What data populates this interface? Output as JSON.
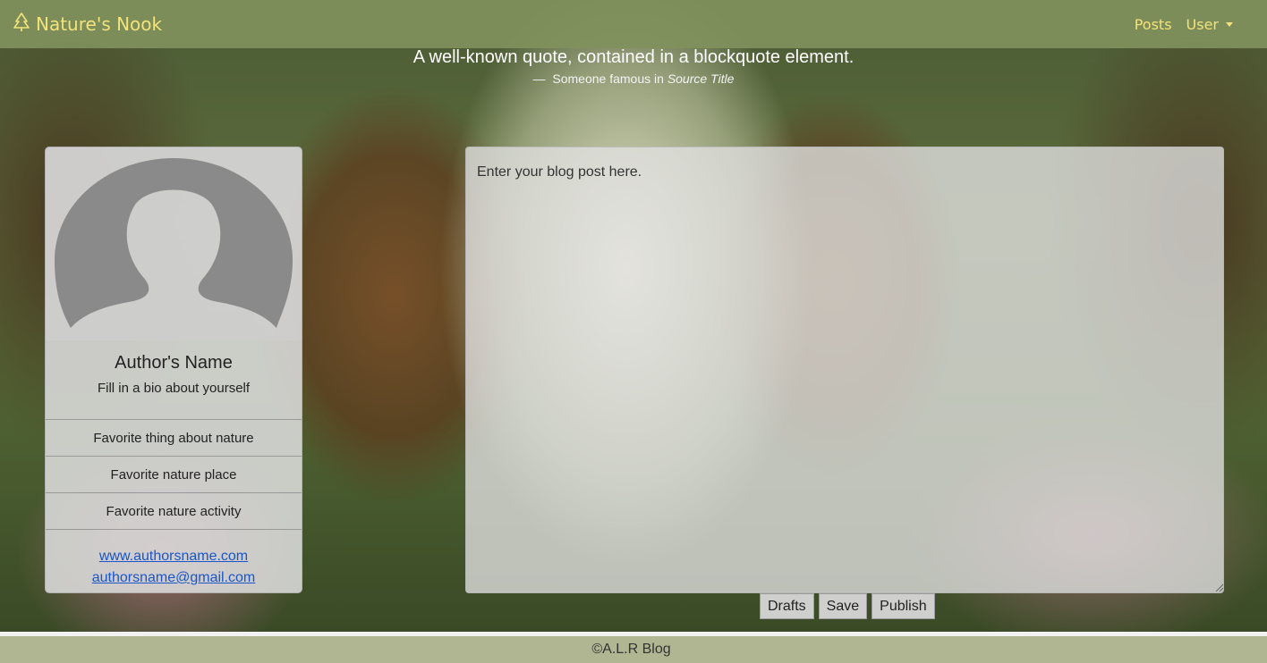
{
  "navbar": {
    "brand": "Nature's Nook",
    "brand_icon": "tree-icon",
    "links": {
      "posts": "Posts",
      "user": "User"
    },
    "accent": "#f2e37a"
  },
  "quote": {
    "text": "A well-known quote, contained in a blockquote element.",
    "dash": "—",
    "source_prefix": "Someone famous in",
    "source_title": "Source Title"
  },
  "profile": {
    "avatar_icon": "user-silhouette-icon",
    "name": "Author's Name",
    "bio": "Fill in a bio about yourself",
    "items": [
      "Favorite thing about nature",
      "Favorite nature place",
      "Favorite nature activity"
    ],
    "website": "www.authorsname.com",
    "email": "authorsname@gmail.com"
  },
  "editor": {
    "placeholder": "Enter your blog post here."
  },
  "buttons": {
    "drafts": "Drafts",
    "save": "Save",
    "publish": "Publish"
  },
  "footer": {
    "text": "©A.L.R Blog"
  }
}
